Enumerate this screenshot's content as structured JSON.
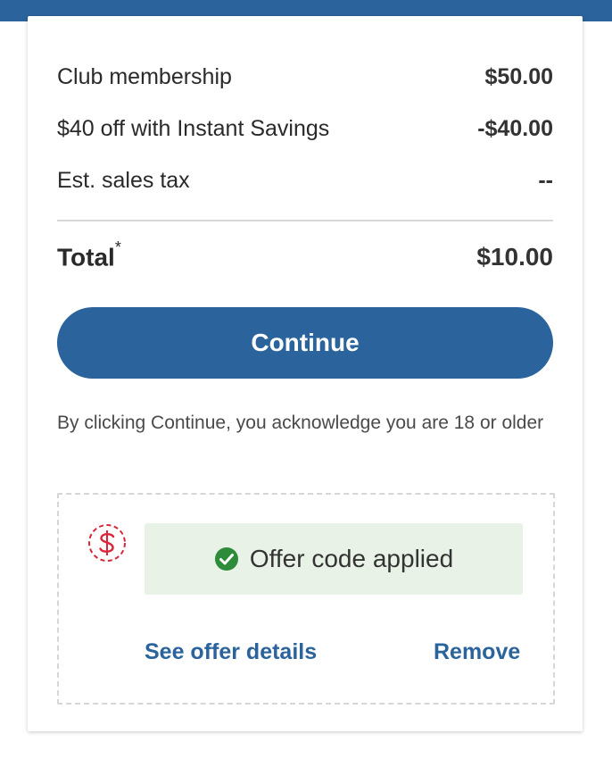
{
  "summary": {
    "rows": [
      {
        "label": "Club membership",
        "amount": "$50.00"
      },
      {
        "label": "$40 off with Instant Savings",
        "amount": "-$40.00"
      },
      {
        "label": "Est. sales tax",
        "amount": "--"
      }
    ],
    "total_label": "Total",
    "total_marker": "*",
    "total_amount": "$10.00"
  },
  "continue_label": "Continue",
  "disclaimer": "By clicking Continue, you acknowledge you are 18 or older",
  "offer": {
    "status": "Offer code applied",
    "see_details_label": "See offer details",
    "remove_label": "Remove",
    "icon": "dollar-coupon-icon",
    "status_icon": "check-circle-icon"
  },
  "colors": {
    "brand_blue": "#2b639c",
    "success_green": "#2e8b3a",
    "coupon_red": "#d9263a",
    "banner_bg": "#e8f2e6"
  }
}
